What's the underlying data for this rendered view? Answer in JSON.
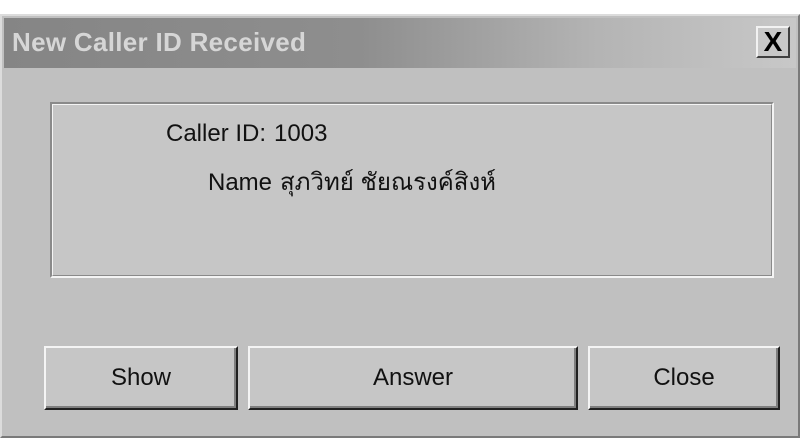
{
  "window": {
    "title": "New Caller ID Received",
    "close_glyph": "X"
  },
  "caller": {
    "id_label": "Caller ID:",
    "id_value": "1003",
    "name_label": "Name",
    "name_value": "สุภวิทย์ ชัยณรงค์สิงห์"
  },
  "buttons": {
    "show": "Show",
    "answer": "Answer",
    "close": "Close"
  }
}
